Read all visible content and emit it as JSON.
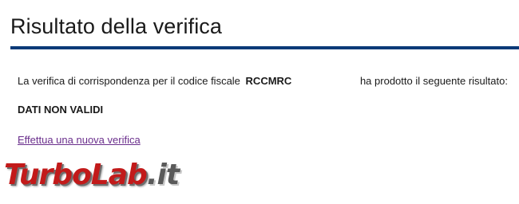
{
  "page": {
    "title": "Risultato della verifica",
    "accent_color": "#0b3a78"
  },
  "result": {
    "text_before": "La verifica di corrispondenza per il codice fiscale",
    "codice_fiscale_visible": "RCCMRC",
    "text_after": "ha prodotto il seguente risultato:",
    "status": "DATI NON VALIDI"
  },
  "actions": {
    "new_check_link": "Effettua una nuova verifica"
  },
  "watermark": {
    "brand_main": "TurboLab",
    "brand_tail": ".it"
  }
}
